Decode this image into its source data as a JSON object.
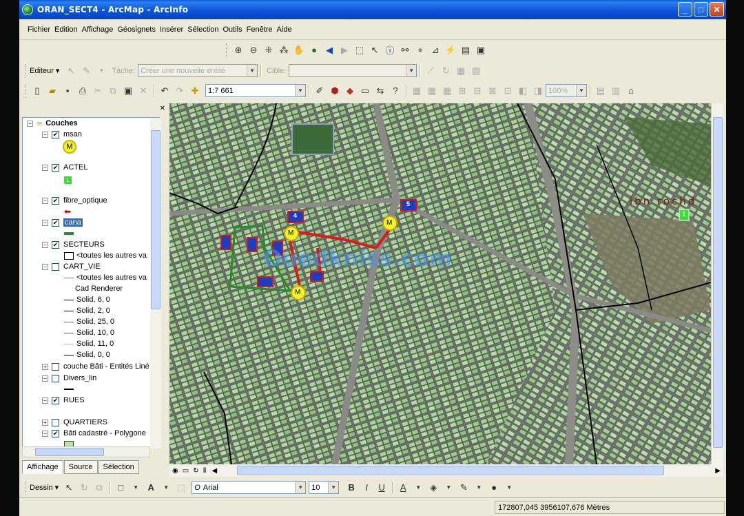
{
  "window": {
    "title": "ORAN_SECT4 - ArcMap - ArcInfo",
    "minimize": "_",
    "maximize": "□",
    "close": "✕"
  },
  "menu": [
    "Fichier",
    "Edition",
    "Affichage",
    "Géosignets",
    "Insérer",
    "Sélection",
    "Outils",
    "Fenêtre",
    "Aide"
  ],
  "editor": {
    "editeur_label": "Editeur ▾",
    "tache_label": "Tâche:",
    "tache_value": "Créer une nouvelle entité",
    "cible_label": "Cible:",
    "cible_value": ""
  },
  "standard": {
    "scale": "1:7 661"
  },
  "georef": {
    "zoom": "100%"
  },
  "toc": {
    "root": "Couches",
    "layers": [
      {
        "name": "msan",
        "checked": true
      },
      {
        "name": "ACTEL",
        "checked": true
      },
      {
        "name": "fibre_optique",
        "checked": true
      },
      {
        "name": "cana",
        "checked": true
      },
      {
        "name": "SECTEURS",
        "checked": true
      },
      {
        "name": "CART_VIE",
        "checked": false
      },
      {
        "name": "couche Bâti - Entités Liné",
        "checked": false
      },
      {
        "name": "Divers_lin",
        "checked": false
      },
      {
        "name": "RUES",
        "checked": true
      },
      {
        "name": "QUARTIERS",
        "checked": false
      },
      {
        "name": "Bâti cadastré - Polygone",
        "checked": true
      }
    ],
    "legend": {
      "msan_symbol": "M",
      "actel_symbol": "1",
      "secteurs_all": "<toutes les autres va",
      "cart_all": "<toutes les autres va",
      "cad_renderer": "Cad Renderer",
      "solids": [
        "Solid, 6, 0",
        "Solid, 2, 0",
        "Solid, 25, 0",
        "Solid, 10, 0",
        "Solid, 11, 0",
        "Solid, 0, 0"
      ]
    },
    "tabs": [
      "Affichage",
      "Source",
      "Sélection"
    ]
  },
  "map": {
    "label_ibn_rochd": "ibn rochd",
    "msan_marker": "M",
    "actel_marker": "1",
    "highway_4": "4",
    "highway_5": "5",
    "watermark": "Ouedkniss.com"
  },
  "draw": {
    "dessin_label": "Dessin ▾",
    "font_name": "Arial",
    "font_size": "10",
    "bold": "B",
    "italic": "I",
    "underline": "U"
  },
  "status": {
    "coords": "172807,045  3956107,676 Mètres"
  }
}
